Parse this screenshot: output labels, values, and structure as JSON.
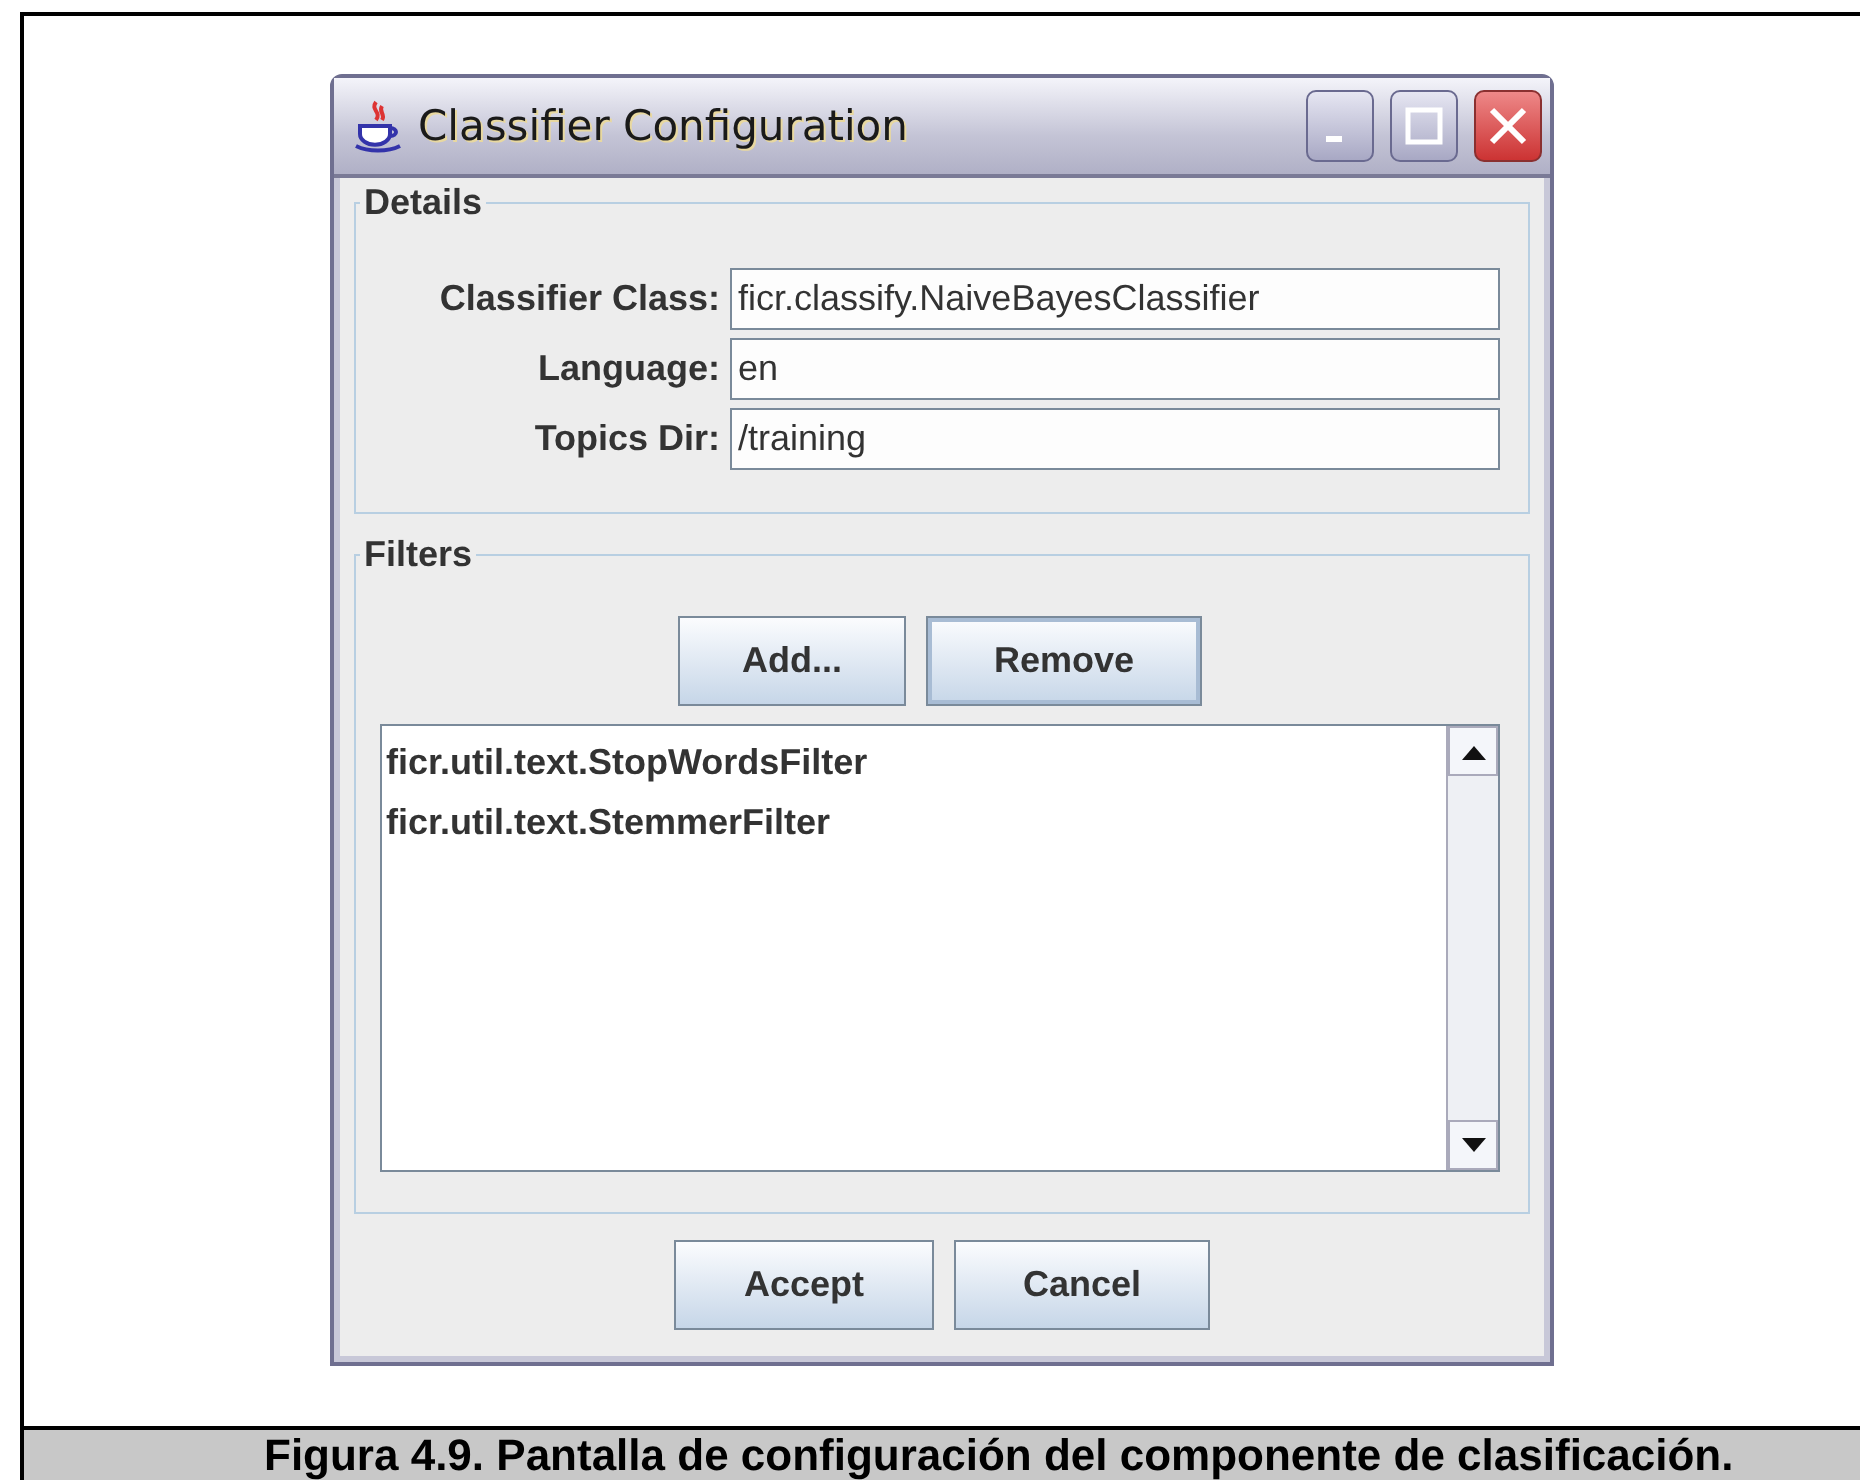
{
  "window": {
    "title": "Classifier Configuration"
  },
  "details": {
    "title": "Details",
    "fields": [
      {
        "label": "Classifier Class:",
        "value": "ficr.classify.NaiveBayesClassifier"
      },
      {
        "label": "Language:",
        "value": "en"
      },
      {
        "label": "Topics Dir:",
        "value": "/training"
      }
    ]
  },
  "filters": {
    "title": "Filters",
    "buttons": [
      {
        "label": "Add...",
        "focused": false
      },
      {
        "label": "Remove",
        "focused": true
      }
    ],
    "items": [
      "ficr.util.text.StopWordsFilter",
      "ficr.util.text.StemmerFilter"
    ]
  },
  "buttons": [
    "Accept",
    "Cancel"
  ],
  "caption": "Figura 4.9. Pantalla de configuración del componente de clasificación."
}
